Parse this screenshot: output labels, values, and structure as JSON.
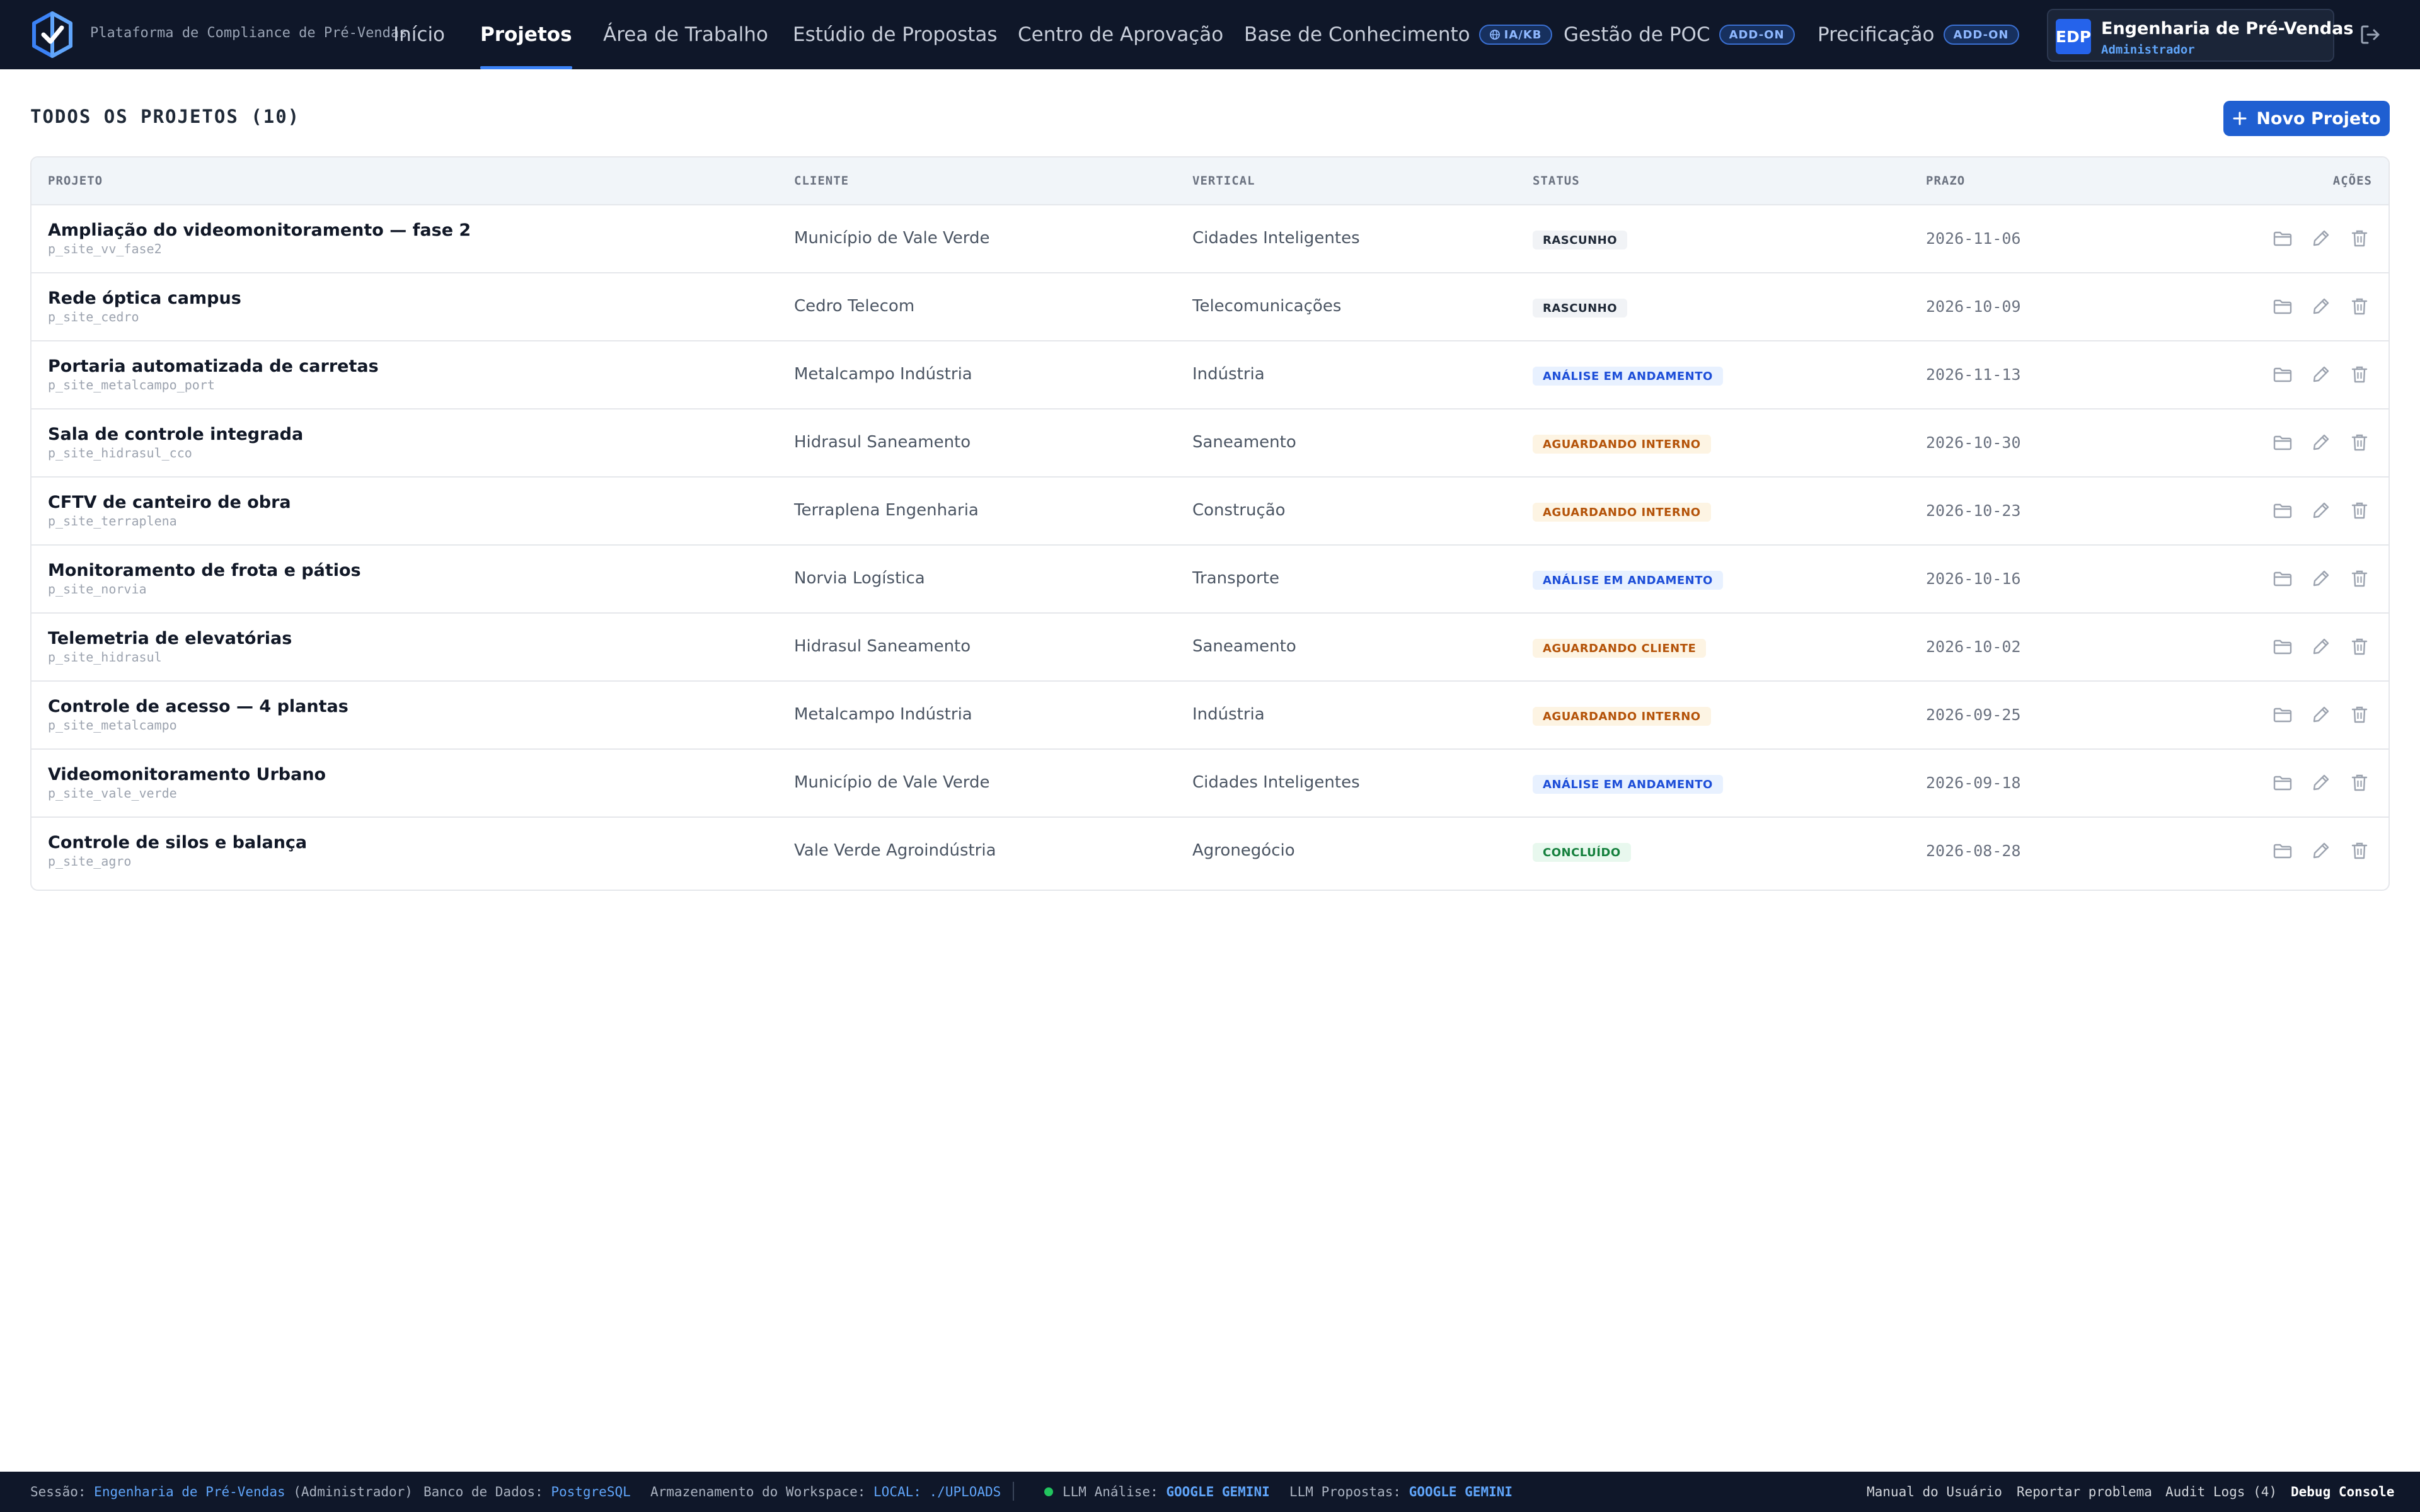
{
  "app": {
    "platform_name": "Plataforma de Compliance de Pré-Vendas",
    "brand_color": "#1f5fd1"
  },
  "nav": {
    "items": [
      {
        "label": "Início",
        "active": false
      },
      {
        "label": "Projetos",
        "active": true
      },
      {
        "label": "Área de Trabalho",
        "active": false
      },
      {
        "label": "Estúdio de Propostas",
        "active": false
      },
      {
        "label": "Centro de Aprovação",
        "active": false
      },
      {
        "label": "Base de Conhecimento",
        "badge": "IA/KB",
        "badge_icon": "globe-icon",
        "active": false
      },
      {
        "label": "Gestão de POC",
        "badge": "ADD-ON",
        "active": false
      },
      {
        "label": "Precificação",
        "badge": "ADD-ON",
        "active": false
      }
    ]
  },
  "user": {
    "initials": "EDP",
    "name": "Engenharia de Pré-Vendas",
    "role": "Administrador"
  },
  "page": {
    "title": "TODOS OS PROJETOS (10)",
    "new_button_label": "Novo Projeto"
  },
  "table": {
    "headers": {
      "project": "PROJETO",
      "client": "CLIENTE",
      "vertical": "VERTICAL",
      "status": "STATUS",
      "deadline": "PRAZO",
      "actions": "AÇÕES"
    },
    "rows": [
      {
        "name": "Ampliação do videomonitoramento — fase 2",
        "id": "p_site_vv_fase2",
        "client": "Município de Vale Verde",
        "vertical": "Cidades Inteligentes",
        "status": "RASCUNHO",
        "status_kind": "rascunho",
        "deadline": "2026-11-06"
      },
      {
        "name": "Rede óptica campus",
        "id": "p_site_cedro",
        "client": "Cedro Telecom",
        "vertical": "Telecomunicações",
        "status": "RASCUNHO",
        "status_kind": "rascunho",
        "deadline": "2026-10-09"
      },
      {
        "name": "Portaria automatizada de carretas",
        "id": "p_site_metalcampo_port",
        "client": "Metalcampo Indústria",
        "vertical": "Indústria",
        "status": "ANÁLISE EM ANDAMENTO",
        "status_kind": "analise",
        "deadline": "2026-11-13"
      },
      {
        "name": "Sala de controle integrada",
        "id": "p_site_hidrasul_cco",
        "client": "Hidrasul Saneamento",
        "vertical": "Saneamento",
        "status": "AGUARDANDO INTERNO",
        "status_kind": "aguardando",
        "deadline": "2026-10-30"
      },
      {
        "name": "CFTV de canteiro de obra",
        "id": "p_site_terraplena",
        "client": "Terraplena Engenharia",
        "vertical": "Construção",
        "status": "AGUARDANDO INTERNO",
        "status_kind": "aguardando",
        "deadline": "2026-10-23"
      },
      {
        "name": "Monitoramento de frota e pátios",
        "id": "p_site_norvia",
        "client": "Norvia Logística",
        "vertical": "Transporte",
        "status": "ANÁLISE EM ANDAMENTO",
        "status_kind": "analise",
        "deadline": "2026-10-16"
      },
      {
        "name": "Telemetria de elevatórias",
        "id": "p_site_hidrasul",
        "client": "Hidrasul Saneamento",
        "vertical": "Saneamento",
        "status": "AGUARDANDO CLIENTE",
        "status_kind": "aguardando",
        "deadline": "2026-10-02"
      },
      {
        "name": "Controle de acesso — 4 plantas",
        "id": "p_site_metalcampo",
        "client": "Metalcampo Indústria",
        "vertical": "Indústria",
        "status": "AGUARDANDO INTERNO",
        "status_kind": "aguardando",
        "deadline": "2026-09-25"
      },
      {
        "name": "Videomonitoramento Urbano",
        "id": "p_site_vale_verde",
        "client": "Município de Vale Verde",
        "vertical": "Cidades Inteligentes",
        "status": "ANÁLISE EM ANDAMENTO",
        "status_kind": "analise",
        "deadline": "2026-09-18"
      },
      {
        "name": "Controle de silos e balança",
        "id": "p_site_agro",
        "client": "Vale Verde Agroindústria",
        "vertical": "Agronegócio",
        "status": "CONCLUÍDO",
        "status_kind": "concluido",
        "deadline": "2026-08-28"
      }
    ],
    "row_action_icons": [
      "folder-icon",
      "edit-icon",
      "trash-icon"
    ]
  },
  "footer": {
    "session_label": "Sessão:",
    "session_user": "Engenharia de Pré-Vendas",
    "session_role": "(Administrador)",
    "db_label": "Banco de Dados:",
    "db_value": "PostgreSQL",
    "storage_label": "Armazenamento do Workspace:",
    "storage_value": "LOCAL: ./UPLOADS",
    "llm_analysis_label": "LLM Análise:",
    "llm_analysis_value": "GOOGLE GEMINI",
    "llm_proposals_label": "LLM Propostas:",
    "llm_proposals_value": "GOOGLE GEMINI",
    "links": {
      "manual": "Manual do Usuário",
      "report": "Reportar problema",
      "audit": "Audit Logs (4)",
      "debug": "Debug Console"
    }
  }
}
